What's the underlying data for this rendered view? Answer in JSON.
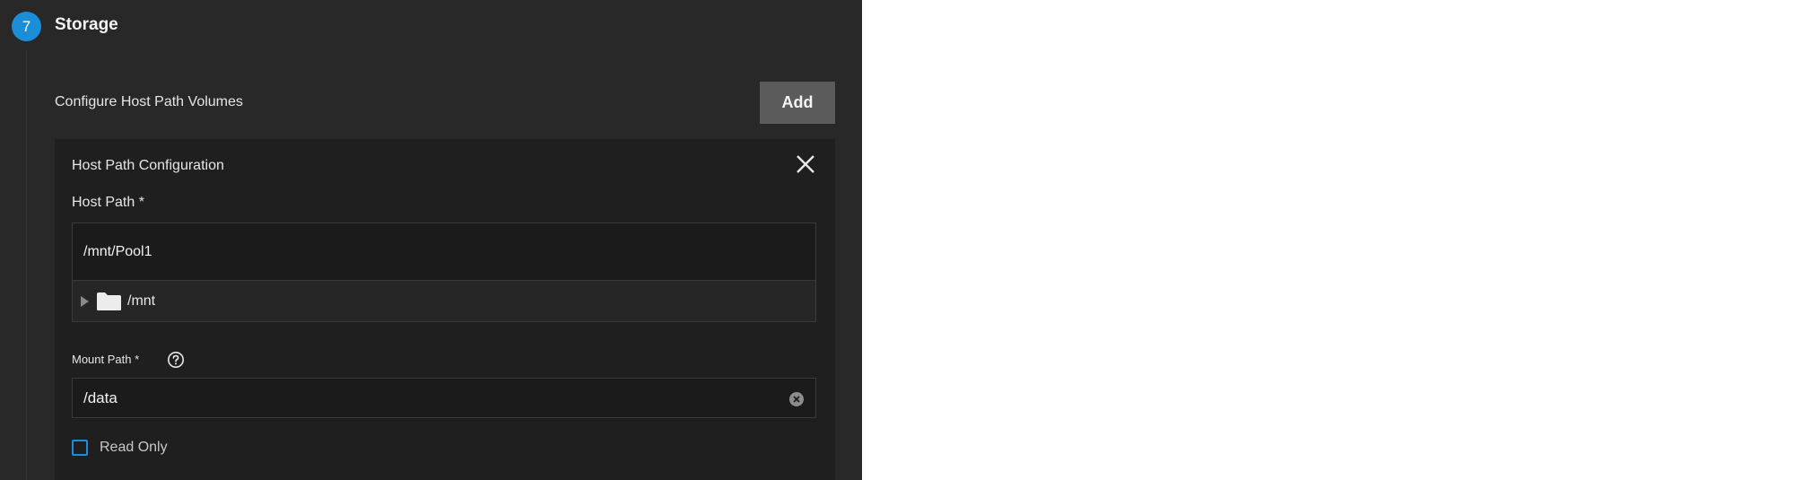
{
  "step": {
    "number": "7",
    "title": "Storage"
  },
  "section": {
    "label": "Configure Host Path Volumes",
    "add_label": "Add"
  },
  "card": {
    "title": "Host Path Configuration",
    "host_path": {
      "label": "Host Path *",
      "value": "/mnt/Pool1",
      "tree_items": [
        {
          "label": "/mnt",
          "icon": "folder-icon",
          "expanded": false
        }
      ]
    },
    "mount_path": {
      "label": "Mount Path *",
      "value": "/data"
    },
    "read_only": {
      "label": "Read Only",
      "checked": false
    }
  },
  "colors": {
    "accent": "#1a8fd8",
    "panel_bg": "#282828",
    "card_bg": "#1f1f1f",
    "button_bg": "#5b5b5b"
  }
}
